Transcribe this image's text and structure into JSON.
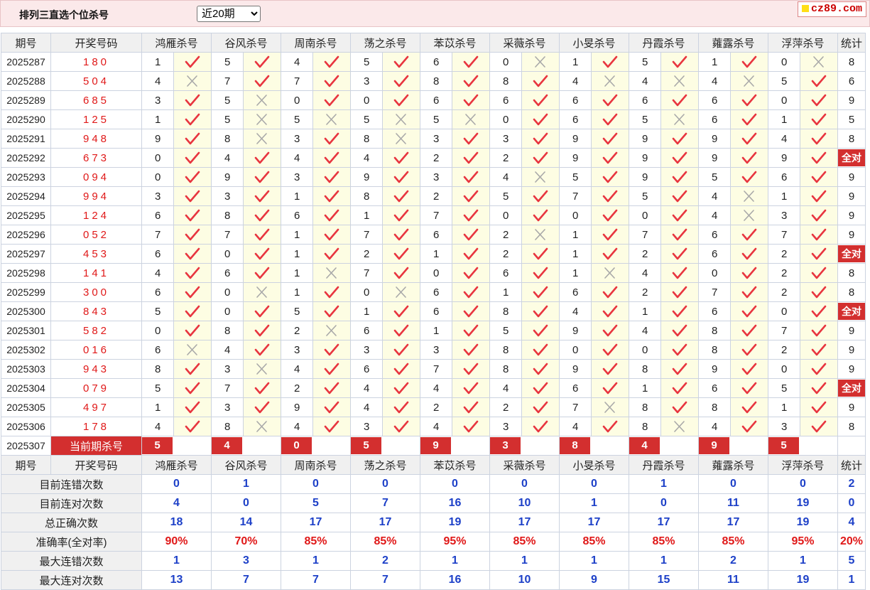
{
  "header": {
    "title": "排列三直选个位杀号",
    "range_selected": "近20期",
    "brand": "cz89.com"
  },
  "table": {
    "col_issue": "期号",
    "col_win": "开奖号码",
    "experts": [
      "鸿雁杀号",
      "谷风杀号",
      "周南杀号",
      "荡之杀号",
      "苯苡杀号",
      "采薇杀号",
      "小旻杀号",
      "丹霞杀号",
      "蕹露杀号",
      "浮萍杀号"
    ],
    "col_stat": "统计",
    "all_correct_label": "全对",
    "rows": [
      {
        "issue": "2025287",
        "win": "180",
        "kills": [
          1,
          5,
          4,
          5,
          6,
          0,
          1,
          5,
          1,
          0
        ],
        "ok": [
          1,
          1,
          1,
          1,
          1,
          0,
          1,
          1,
          1,
          0
        ],
        "stat": "8"
      },
      {
        "issue": "2025288",
        "win": "504",
        "kills": [
          4,
          7,
          7,
          3,
          8,
          8,
          4,
          4,
          4,
          5
        ],
        "ok": [
          0,
          1,
          1,
          1,
          1,
          1,
          0,
          0,
          0,
          1
        ],
        "stat": "6"
      },
      {
        "issue": "2025289",
        "win": "685",
        "kills": [
          3,
          5,
          0,
          0,
          6,
          6,
          6,
          6,
          6,
          0
        ],
        "ok": [
          1,
          0,
          1,
          1,
          1,
          1,
          1,
          1,
          1,
          1
        ],
        "stat": "9"
      },
      {
        "issue": "2025290",
        "win": "125",
        "kills": [
          1,
          5,
          5,
          5,
          5,
          0,
          6,
          5,
          6,
          1
        ],
        "ok": [
          1,
          0,
          0,
          0,
          0,
          1,
          1,
          0,
          1,
          1
        ],
        "stat": "5"
      },
      {
        "issue": "2025291",
        "win": "948",
        "kills": [
          9,
          8,
          3,
          8,
          3,
          3,
          9,
          9,
          9,
          4
        ],
        "ok": [
          1,
          0,
          1,
          0,
          1,
          1,
          1,
          1,
          1,
          1
        ],
        "stat": "8"
      },
      {
        "issue": "2025292",
        "win": "673",
        "kills": [
          0,
          4,
          4,
          4,
          2,
          2,
          9,
          9,
          9,
          9
        ],
        "ok": [
          1,
          1,
          1,
          1,
          1,
          1,
          1,
          1,
          1,
          1
        ],
        "stat": "all"
      },
      {
        "issue": "2025293",
        "win": "094",
        "kills": [
          0,
          9,
          3,
          9,
          3,
          4,
          5,
          9,
          5,
          6
        ],
        "ok": [
          1,
          1,
          1,
          1,
          1,
          0,
          1,
          1,
          1,
          1
        ],
        "stat": "9"
      },
      {
        "issue": "2025294",
        "win": "994",
        "kills": [
          3,
          3,
          1,
          8,
          2,
          5,
          7,
          5,
          4,
          1
        ],
        "ok": [
          1,
          1,
          1,
          1,
          1,
          1,
          1,
          1,
          0,
          1
        ],
        "stat": "9"
      },
      {
        "issue": "2025295",
        "win": "124",
        "kills": [
          6,
          8,
          6,
          1,
          7,
          0,
          0,
          0,
          4,
          3
        ],
        "ok": [
          1,
          1,
          1,
          1,
          1,
          1,
          1,
          1,
          0,
          1
        ],
        "stat": "9"
      },
      {
        "issue": "2025296",
        "win": "052",
        "kills": [
          7,
          7,
          1,
          7,
          6,
          2,
          1,
          7,
          6,
          7
        ],
        "ok": [
          1,
          1,
          1,
          1,
          1,
          0,
          1,
          1,
          1,
          1
        ],
        "stat": "9"
      },
      {
        "issue": "2025297",
        "win": "453",
        "kills": [
          6,
          0,
          1,
          2,
          1,
          2,
          1,
          2,
          6,
          2
        ],
        "ok": [
          1,
          1,
          1,
          1,
          1,
          1,
          1,
          1,
          1,
          1
        ],
        "stat": "all"
      },
      {
        "issue": "2025298",
        "win": "141",
        "kills": [
          4,
          6,
          1,
          7,
          0,
          6,
          1,
          4,
          0,
          2
        ],
        "ok": [
          1,
          1,
          0,
          1,
          1,
          1,
          0,
          1,
          1,
          1
        ],
        "stat": "8"
      },
      {
        "issue": "2025299",
        "win": "300",
        "kills": [
          6,
          0,
          1,
          0,
          6,
          1,
          6,
          2,
          7,
          2
        ],
        "ok": [
          1,
          0,
          1,
          0,
          1,
          1,
          1,
          1,
          1,
          1
        ],
        "stat": "8"
      },
      {
        "issue": "2025300",
        "win": "843",
        "kills": [
          5,
          0,
          5,
          1,
          6,
          8,
          4,
          1,
          6,
          0
        ],
        "ok": [
          1,
          1,
          1,
          1,
          1,
          1,
          1,
          1,
          1,
          1
        ],
        "stat": "all"
      },
      {
        "issue": "2025301",
        "win": "582",
        "kills": [
          0,
          8,
          2,
          6,
          1,
          5,
          9,
          4,
          8,
          7
        ],
        "ok": [
          1,
          1,
          0,
          1,
          1,
          1,
          1,
          1,
          1,
          1
        ],
        "stat": "9"
      },
      {
        "issue": "2025302",
        "win": "016",
        "kills": [
          6,
          4,
          3,
          3,
          3,
          8,
          0,
          0,
          8,
          2
        ],
        "ok": [
          0,
          1,
          1,
          1,
          1,
          1,
          1,
          1,
          1,
          1
        ],
        "stat": "9"
      },
      {
        "issue": "2025303",
        "win": "943",
        "kills": [
          8,
          3,
          4,
          6,
          7,
          8,
          9,
          8,
          9,
          0
        ],
        "ok": [
          1,
          0,
          1,
          1,
          1,
          1,
          1,
          1,
          1,
          1
        ],
        "stat": "9"
      },
      {
        "issue": "2025304",
        "win": "079",
        "kills": [
          5,
          7,
          2,
          4,
          4,
          4,
          6,
          1,
          6,
          5
        ],
        "ok": [
          1,
          1,
          1,
          1,
          1,
          1,
          1,
          1,
          1,
          1
        ],
        "stat": "all"
      },
      {
        "issue": "2025305",
        "win": "497",
        "kills": [
          1,
          3,
          9,
          4,
          2,
          2,
          7,
          8,
          8,
          1
        ],
        "ok": [
          1,
          1,
          1,
          1,
          1,
          1,
          0,
          1,
          1,
          1
        ],
        "stat": "9"
      },
      {
        "issue": "2025306",
        "win": "178",
        "kills": [
          4,
          8,
          4,
          3,
          4,
          3,
          4,
          8,
          4,
          3
        ],
        "ok": [
          1,
          0,
          1,
          1,
          1,
          1,
          1,
          0,
          1,
          1
        ],
        "stat": "8"
      }
    ],
    "current": {
      "issue": "2025307",
      "label": "当前期杀号",
      "kills": [
        "5",
        "4",
        "0",
        "5",
        "9",
        "3",
        "8",
        "4",
        "9",
        "5"
      ]
    }
  },
  "stats": {
    "rows": [
      {
        "label": "目前连错次数",
        "values": [
          "0",
          "1",
          "0",
          "0",
          "0",
          "0",
          "0",
          "1",
          "0",
          "0",
          "2"
        ],
        "red": false
      },
      {
        "label": "目前连对次数",
        "values": [
          "4",
          "0",
          "5",
          "7",
          "16",
          "10",
          "1",
          "0",
          "11",
          "19",
          "0"
        ],
        "red": false
      },
      {
        "label": "总正确次数",
        "values": [
          "18",
          "14",
          "17",
          "17",
          "19",
          "17",
          "17",
          "17",
          "17",
          "19",
          "4"
        ],
        "red": false
      },
      {
        "label": "准确率(全对率)",
        "values": [
          "90%",
          "70%",
          "85%",
          "85%",
          "95%",
          "85%",
          "85%",
          "85%",
          "85%",
          "95%",
          "20%"
        ],
        "red": true
      },
      {
        "label": "最大连错次数",
        "values": [
          "1",
          "3",
          "1",
          "2",
          "1",
          "1",
          "1",
          "1",
          "2",
          "1",
          "5"
        ],
        "red": false
      },
      {
        "label": "最大连对次数",
        "values": [
          "13",
          "7",
          "7",
          "7",
          "16",
          "10",
          "9",
          "15",
          "11",
          "19",
          "1"
        ],
        "red": false
      }
    ]
  },
  "colors": {
    "accent_red": "#d32f2f",
    "mark_bg": "#fdfde3",
    "stat_blue": "#1d40c8",
    "header_bg": "#fbe9ea"
  },
  "icons": {
    "correct": "check-icon",
    "wrong": "cross-icon"
  }
}
